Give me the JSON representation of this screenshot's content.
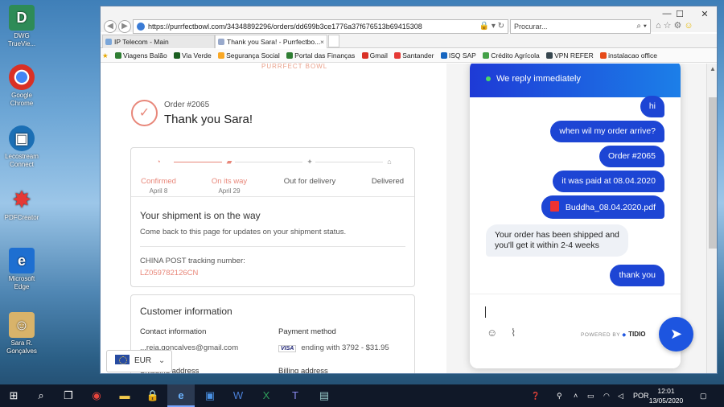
{
  "desktop": {
    "icons": [
      {
        "label": "DWG TrueVie...",
        "glyph": "D",
        "color": "#2e8b57"
      },
      {
        "label": "Google Chrome",
        "glyph": "◉",
        "color": "#d93025"
      },
      {
        "label": "Lecostream Connect",
        "glyph": "▣",
        "color": "#1b6fb5"
      },
      {
        "label": "PDFCreator",
        "glyph": "✸",
        "color": "#c62828"
      },
      {
        "label": "Microsoft Edge",
        "glyph": "e",
        "color": "#1e6fd1"
      },
      {
        "label": "Sara R. Gonçalves",
        "glyph": "☺",
        "color": "#d8b36a"
      }
    ]
  },
  "browser": {
    "url": "https://purrfectbowl.com/34348892296/orders/dd699b3ce1776a37f676513b69415308",
    "search_placeholder": "Procurar...",
    "tabs": [
      {
        "label": "IP Telecom - Main",
        "active": false
      },
      {
        "label": "Thank you Sara! - Purrfectbo...",
        "active": true
      }
    ],
    "favorites": [
      {
        "label": "Viagens Balão",
        "color": "#2e7d32"
      },
      {
        "label": "Via Verde",
        "color": "#1b5e20"
      },
      {
        "label": "Segurança Social",
        "color": "#f9a825"
      },
      {
        "label": "Portal das Finanças",
        "color": "#2e7d32"
      },
      {
        "label": "Gmail",
        "color": "#d93025"
      },
      {
        "label": "Santander",
        "color": "#e53935"
      },
      {
        "label": "ISQ SAP",
        "color": "#1565c0"
      },
      {
        "label": "Crédito Agrícola",
        "color": "#43a047"
      },
      {
        "label": "VPN REFER",
        "color": "#37474f"
      },
      {
        "label": "instalacao office",
        "color": "#e64a19"
      }
    ],
    "window_controls": {
      "minimize": "—",
      "maximize": "☐",
      "close": "✕"
    }
  },
  "page": {
    "brand": "PURRFECT BOWL",
    "order_number": "Order #2065",
    "thank_you": "Thank you Sara!",
    "steps": [
      {
        "label": "Confirmed",
        "date": "April 8",
        "done": true
      },
      {
        "label": "On its way",
        "date": "April 29",
        "done": true
      },
      {
        "label": "Out for delivery",
        "date": "",
        "done": false
      },
      {
        "label": "Delivered",
        "date": "",
        "done": false
      }
    ],
    "shipment_title": "Your shipment is on the way",
    "shipment_sub": "Come back to this page for updates on your shipment status.",
    "tracking_label": "CHINA POST tracking number:",
    "tracking_number": "LZ059782126CN",
    "customer_info_title": "Customer information",
    "contact_label": "Contact information",
    "contact_value": "...reia.goncalves@gmail.com",
    "payment_label": "Payment method",
    "payment_value": "ending with 3792 - $31.95",
    "card_brand": "VISA",
    "shipping_label": "Shipping address",
    "billing_label": "Billing address",
    "currency": "EUR"
  },
  "chat": {
    "header": "We reply immediately",
    "messages": [
      {
        "from": "me",
        "text": "hi"
      },
      {
        "from": "me",
        "text": "when wil my order arrive?"
      },
      {
        "from": "me",
        "text": "Order #2065"
      },
      {
        "from": "me",
        "text": "it was paid at 08.04.2020"
      },
      {
        "from": "me",
        "text": "Buddha_08.04.2020.pdf"
      },
      {
        "from": "op",
        "line1": "Your order has been shipped and",
        "line2": "you'll get it within 2-4 weeks"
      },
      {
        "from": "me",
        "text": "thank you"
      }
    ],
    "powered_by": "POWERED BY",
    "powered_brand": "TIDIO"
  },
  "taskbar": {
    "lang": "POR",
    "time": "12:01",
    "date": "13/05/2020"
  }
}
